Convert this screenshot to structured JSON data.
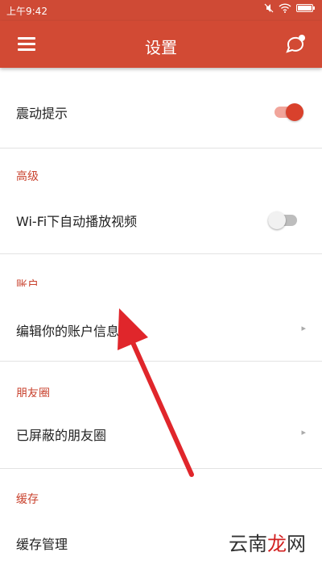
{
  "status_bar": {
    "time": "上午9:42",
    "icons": [
      "mute-icon",
      "wifi-icon",
      "battery-icon"
    ]
  },
  "app_bar": {
    "title": "设置",
    "menu_icon": "hamburger-menu-icon",
    "right_icon": "notification-bubble-icon"
  },
  "settings": {
    "vibration": {
      "label": "震动提示",
      "enabled": true
    },
    "advanced": {
      "header": "高级",
      "wifi_autoplay": {
        "label": "Wi-Fi下自动播放视频",
        "enabled": false
      }
    },
    "account": {
      "header": "账户",
      "edit_account": {
        "label": "编辑你的账户信息"
      }
    },
    "moments": {
      "header": "朋友圈",
      "blocked_moments": {
        "label": "已屏蔽的朋友圈"
      }
    },
    "cache": {
      "header": "缓存",
      "manage": {
        "label": "缓存管理"
      }
    }
  },
  "watermark": {
    "text_black": "云南",
    "text_red": "龙",
    "text_black2": "网"
  },
  "colors": {
    "accent": "#d24a34",
    "toggle_on_track": "#f1a59b",
    "toggle_on_thumb": "#d9412c",
    "toggle_off_track": "#bdbdbd",
    "toggle_off_thumb": "#f1f1f1",
    "annotation_arrow": "#e0262b"
  }
}
